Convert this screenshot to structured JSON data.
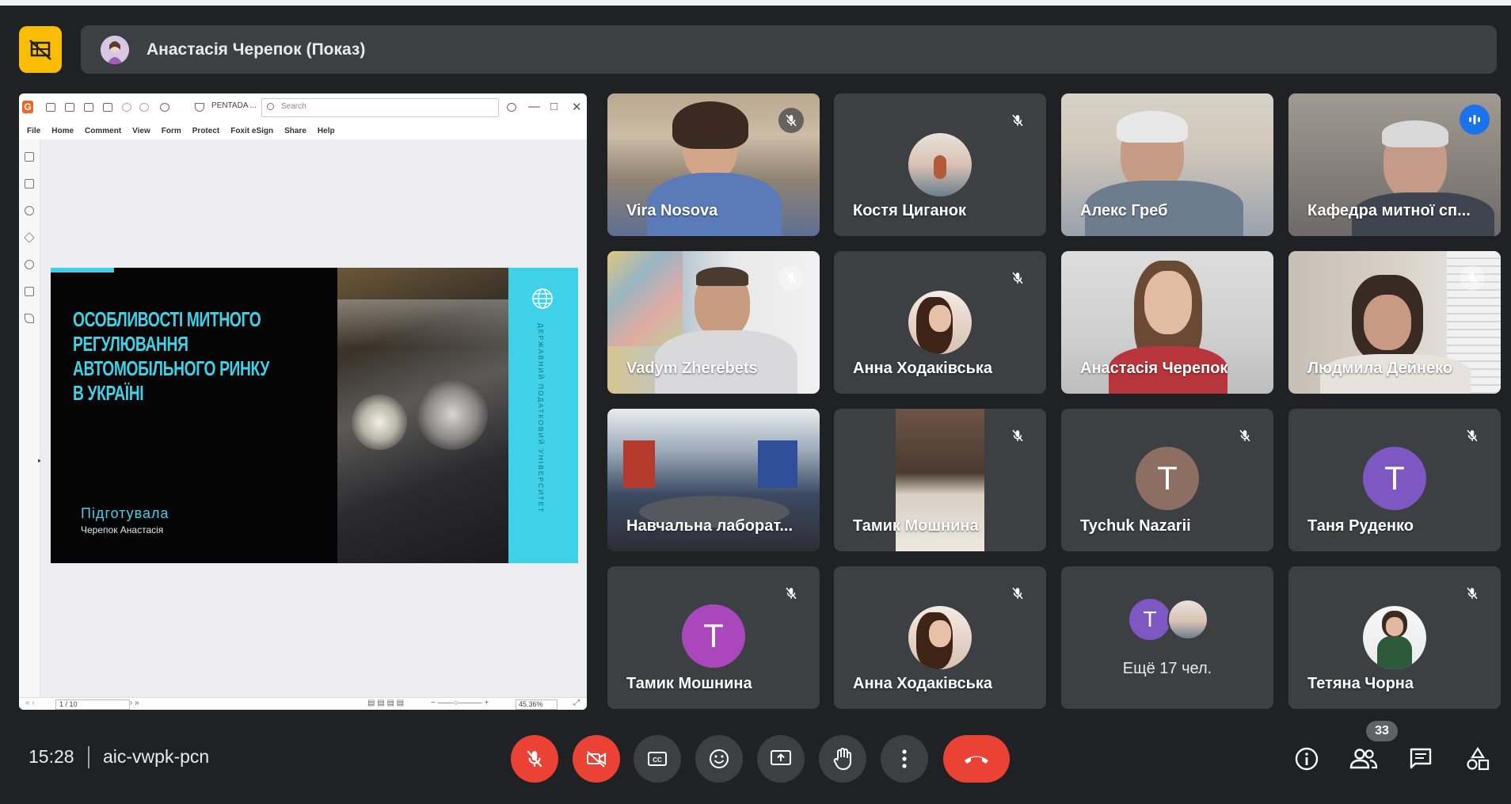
{
  "presenter": {
    "name": "Анастасія Черепок (Показ)"
  },
  "foxit": {
    "doc_name": "PENTADA ...",
    "search_placeholder": "Search",
    "menu": [
      "File",
      "Home",
      "Comment",
      "View",
      "Form",
      "Protect",
      "Foxit eSign",
      "Share",
      "Help"
    ],
    "page": "1 / 10",
    "zoom": "45.36%"
  },
  "slide": {
    "title": "ОСОБЛИВОСТІ МИТНОГО РЕГУЛЮВАННЯ АВТОМОБІЛЬНОГО РИНКУ В УКРАЇНІ",
    "prepared_label": "Підготувала",
    "author": "Черепок Анастасія",
    "university": "ДЕРЖАВНИЙ ПОДАТКОВИЙ УНІВЕРСИТЕТ"
  },
  "participants": [
    {
      "name": "Vira Nosova",
      "muted": true,
      "kind": "video"
    },
    {
      "name": "Костя Циганок",
      "muted": true,
      "kind": "photo"
    },
    {
      "name": "Алекс Греб",
      "muted": false,
      "kind": "video"
    },
    {
      "name": "Кафедра митної сп...",
      "muted": false,
      "kind": "video",
      "speaking": true
    },
    {
      "name": "Vadym Zherebets",
      "muted": true,
      "kind": "video"
    },
    {
      "name": "Анна Ходаківська",
      "muted": true,
      "kind": "photo"
    },
    {
      "name": "Анастасія Черепок",
      "muted": false,
      "kind": "video"
    },
    {
      "name": "Людмила Дейнеко",
      "muted": true,
      "kind": "video"
    },
    {
      "name": "Навчальна лаборат...",
      "muted": false,
      "kind": "video"
    },
    {
      "name": "Тамик Мошнина",
      "muted": true,
      "kind": "video"
    },
    {
      "name": "Tychuk Nazarii",
      "muted": true,
      "kind": "letter",
      "letter": "T",
      "color": "#8d6e63"
    },
    {
      "name": "Таня Руденко",
      "muted": true,
      "kind": "letter",
      "letter": "T",
      "color": "#7e57c2"
    },
    {
      "name": "Тамик Мошнина",
      "muted": true,
      "kind": "letter",
      "letter": "T",
      "color": "#ab47bc"
    },
    {
      "name": "Анна Ходаківська",
      "muted": true,
      "kind": "photo"
    },
    {
      "name": "Ещё 17 чел.",
      "muted": false,
      "kind": "more",
      "letter": "T"
    },
    {
      "name": "Тетяна Чорна",
      "muted": true,
      "kind": "photo"
    }
  ],
  "footer": {
    "time": "15:28",
    "meeting_code": "aic-vwpk-pcn",
    "people_count": "33"
  },
  "colors": {
    "background": "#202124",
    "tile": "#3c4043",
    "danger": "#ea4335",
    "present_accent": "#fbbc04",
    "active_outline": "#8ab4f8",
    "slide_accent": "#3fd1e8"
  }
}
